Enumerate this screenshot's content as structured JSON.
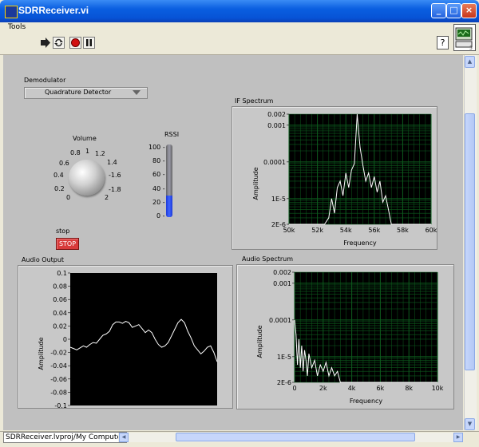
{
  "window": {
    "title": "SDRReceiver.vi",
    "minimize": "_",
    "maximize": "□",
    "close": "×"
  },
  "menu": {
    "tools": "Tools"
  },
  "toolbar": {
    "help": "?"
  },
  "status": {
    "path": "SDRReceiver.lvproj/My Computer"
  },
  "demodulator": {
    "label": "Demodulator",
    "value": "Quadrature Detector"
  },
  "volume": {
    "label": "Volume",
    "ticks": [
      "0",
      "0.2",
      "0.4",
      "0.6",
      "0.8",
      "1",
      "1.2",
      "1.4",
      "1.6",
      "1.8",
      "2"
    ],
    "value": 1.0
  },
  "rssi": {
    "label": "RSSI",
    "ticks": [
      "100",
      "80",
      "60",
      "40",
      "20",
      "0"
    ],
    "value": 30
  },
  "stop": {
    "label": "stop",
    "button": "STOP"
  },
  "colors": {
    "plot_bg": "#000000",
    "trace": "#ffffff",
    "grid": "#0d5c1e",
    "stop_red": "#d83b3b",
    "rssi_blue": "#3050f0",
    "panel": "#c0c0c0"
  },
  "chart_data": [
    {
      "type": "line",
      "title": "IF Spectrum",
      "xlabel": "Frequency",
      "ylabel": "Amplitude",
      "x_ticks": [
        "50k",
        "52k",
        "54k",
        "56k",
        "58k",
        "60k"
      ],
      "y_ticks": [
        "0.002",
        "0.001",
        "0.0001",
        "1E-5",
        "2E-6"
      ],
      "xlim": [
        50000,
        60000
      ],
      "ylim": [
        2e-06,
        0.002
      ],
      "y_scale": "log",
      "series": [
        {
          "x": [
            50000,
            52500,
            52800,
            53000,
            53200,
            53400,
            53600,
            53800,
            54000,
            54200,
            54400,
            54600,
            54800,
            55000,
            55200,
            55400,
            55600,
            55800,
            56000,
            56200,
            56400,
            56600,
            56800,
            57000,
            57200,
            60000
          ],
          "y": [
            2e-06,
            2e-06,
            3e-06,
            1e-05,
            4e-06,
            2e-05,
            3e-05,
            1.2e-05,
            5e-05,
            2e-05,
            6e-05,
            9e-05,
            0.002,
            0.00025,
            8e-05,
            3e-05,
            5e-05,
            2e-05,
            4e-05,
            1.5e-05,
            3e-05,
            8e-06,
            1.2e-05,
            5e-06,
            2e-06,
            2e-06
          ]
        }
      ]
    },
    {
      "type": "line",
      "title": "Audio Output",
      "ylabel": "Amplitude",
      "y_ticks": [
        "0.1",
        "0.08",
        "0.06",
        "0.04",
        "0.02",
        "0",
        "-0.02",
        "-0.04",
        "-0.06",
        "-0.08",
        "-0.1"
      ],
      "ylim": [
        -0.1,
        0.1
      ],
      "series": [
        {
          "x": [
            0,
            4,
            8,
            12,
            16,
            20,
            24,
            28,
            32,
            36,
            40,
            44,
            48,
            52,
            56,
            60,
            64,
            68,
            72,
            76,
            80,
            84,
            88,
            92,
            96,
            100,
            104,
            108,
            112,
            116,
            120,
            124,
            128,
            132,
            136,
            140,
            144,
            148,
            152,
            156,
            160,
            164,
            168,
            172,
            176,
            180
          ],
          "y": [
            -0.012,
            -0.014,
            -0.016,
            -0.013,
            -0.01,
            -0.012,
            -0.008,
            -0.005,
            -0.006,
            0.0,
            0.006,
            0.008,
            0.012,
            0.022,
            0.026,
            0.026,
            0.024,
            0.027,
            0.025,
            0.018,
            0.02,
            0.022,
            0.016,
            0.01,
            0.014,
            0.01,
            0.0,
            -0.008,
            -0.012,
            -0.01,
            -0.005,
            0.005,
            0.015,
            0.025,
            0.03,
            0.025,
            0.012,
            0.002,
            -0.01,
            -0.016,
            -0.022,
            -0.018,
            -0.012,
            -0.01,
            -0.02,
            -0.034
          ]
        }
      ]
    },
    {
      "type": "line",
      "title": "Audio Spectrum",
      "xlabel": "Frequency",
      "ylabel": "Amplitude",
      "x_ticks": [
        "0",
        "2k",
        "4k",
        "6k",
        "8k",
        "10k"
      ],
      "y_ticks": [
        "0.002",
        "0.001",
        "0.0001",
        "1E-5",
        "2E-6"
      ],
      "xlim": [
        0,
        10000
      ],
      "ylim": [
        2e-06,
        0.002
      ],
      "y_scale": "log",
      "series": [
        {
          "x": [
            0,
            100,
            200,
            300,
            400,
            500,
            600,
            700,
            800,
            900,
            1000,
            1200,
            1400,
            1600,
            1800,
            2000,
            2200,
            2400,
            2600,
            2800,
            3000,
            3200,
            10000
          ],
          "y": [
            0.0001,
            4e-05,
            6e-06,
            3e-05,
            5e-06,
            2e-05,
            4e-06,
            1.5e-05,
            8e-06,
            3e-06,
            1.2e-05,
            5e-06,
            8e-06,
            3e-06,
            6e-06,
            4e-06,
            7e-06,
            3e-06,
            5e-06,
            3e-06,
            4e-06,
            2e-06,
            2e-06
          ]
        }
      ]
    }
  ]
}
